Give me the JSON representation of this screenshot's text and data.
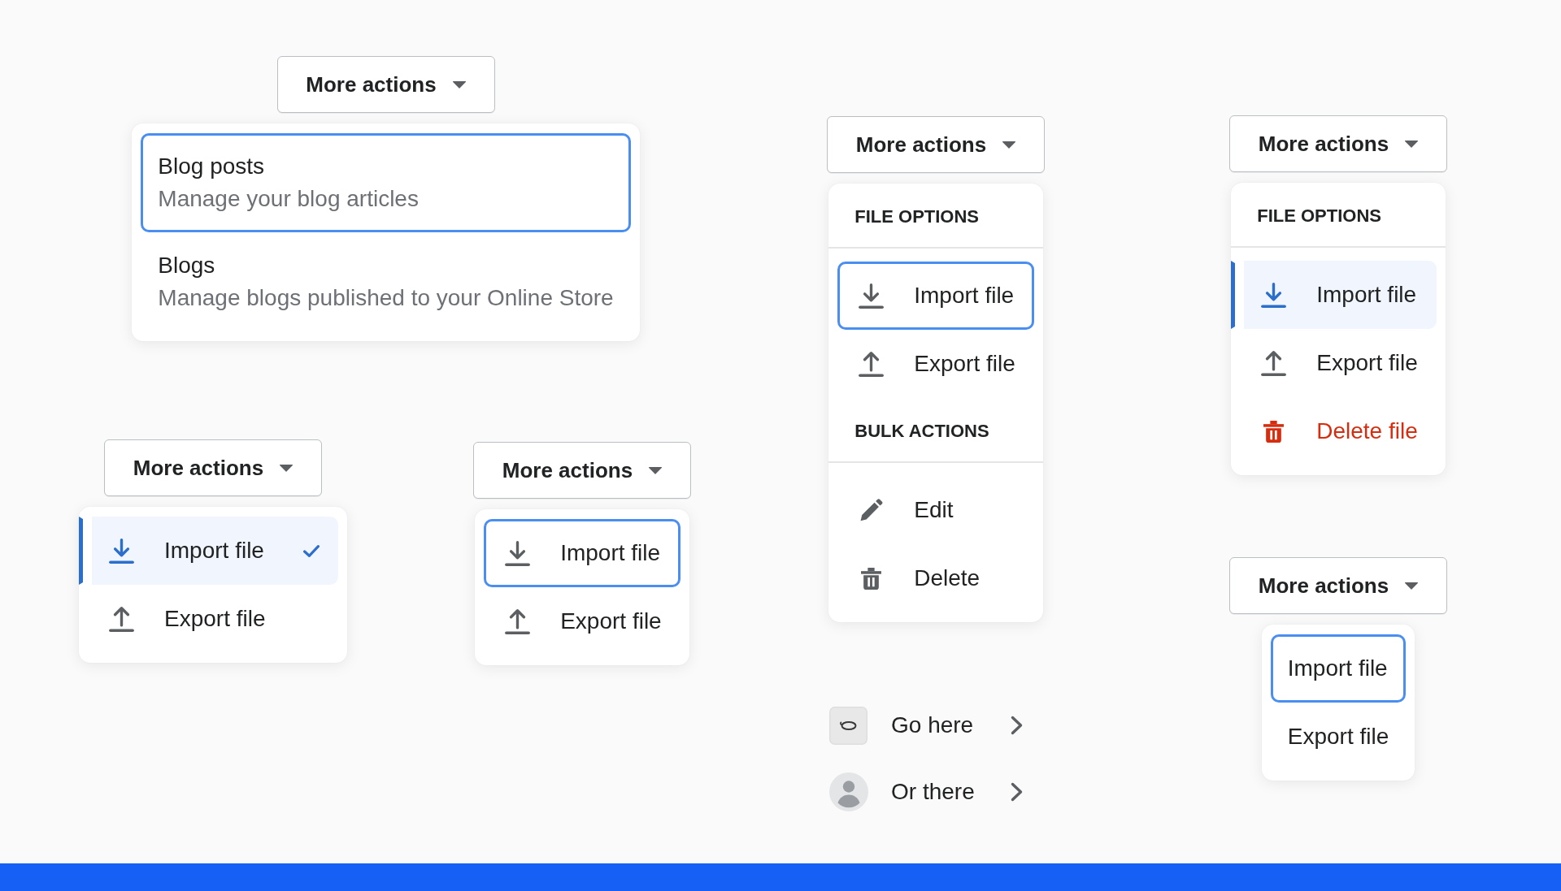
{
  "dropdowns": [
    {
      "button": {
        "label": "More actions"
      },
      "menu": {
        "items": [
          {
            "title": "Blog posts",
            "description": "Manage your blog articles",
            "focused": true
          },
          {
            "title": "Blogs",
            "description": "Manage blogs published to your Online Store",
            "focused": false
          }
        ]
      }
    },
    {
      "button": {
        "label": "More actions"
      },
      "menu": {
        "items": [
          {
            "kind": "import",
            "label": "Import file",
            "selected": true,
            "checked": true
          },
          {
            "kind": "export",
            "label": "Export file",
            "selected": false,
            "checked": false
          }
        ]
      }
    },
    {
      "button": {
        "label": "More actions"
      },
      "menu": {
        "items": [
          {
            "kind": "import",
            "label": "Import file",
            "focused": true
          },
          {
            "kind": "export",
            "label": "Export file",
            "focused": false
          }
        ]
      }
    },
    {
      "button": {
        "label": "More actions"
      },
      "menu": {
        "sections": [
          {
            "title": "FILE OPTIONS",
            "items": [
              {
                "kind": "import",
                "label": "Import file",
                "focused": true
              },
              {
                "kind": "export",
                "label": "Export file",
                "focused": false
              }
            ]
          },
          {
            "title": "BULK ACTIONS",
            "items": [
              {
                "kind": "edit",
                "label": "Edit",
                "focused": false
              },
              {
                "kind": "delete",
                "label": "Delete",
                "focused": false
              }
            ]
          }
        ]
      }
    },
    {
      "button": {
        "label": "More actions"
      },
      "menu": {
        "sections": [
          {
            "title": "FILE OPTIONS",
            "items": [
              {
                "kind": "import",
                "label": "Import file",
                "selected": true,
                "destructive": false
              },
              {
                "kind": "export",
                "label": "Export file",
                "selected": false,
                "destructive": false
              },
              {
                "kind": "delete",
                "label": "Delete file",
                "selected": false,
                "destructive": true
              }
            ]
          }
        ]
      }
    },
    {
      "button": {
        "label": "More actions"
      },
      "menu": {
        "items": [
          {
            "label": "Import file",
            "focused": true
          },
          {
            "label": "Export file",
            "focused": false
          }
        ]
      }
    }
  ],
  "links": [
    {
      "kind": "thumbnail",
      "label": "Go here"
    },
    {
      "kind": "avatar",
      "label": "Or there"
    }
  ]
}
